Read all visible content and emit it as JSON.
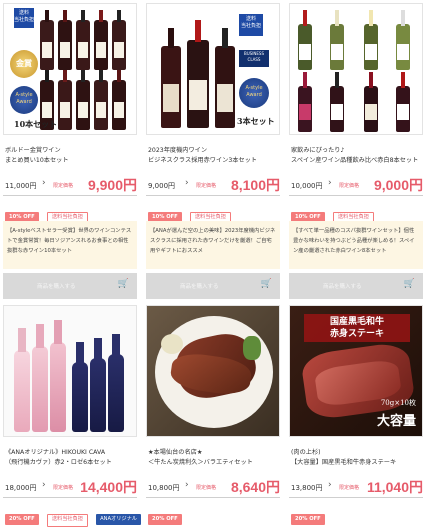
{
  "products": [
    {
      "title": "ボルドー金賞ワイン\nまとめ買い10本セット",
      "regular_price": "11,000円",
      "sale_label": "限定価格",
      "sale_price": "9,900円",
      "tags": [
        "10% OFF",
        "送料当社負担"
      ],
      "image_texts": {
        "badge": "送料\n当社負担",
        "gold": "金賞",
        "award": "A-style\nAward",
        "set": "10本セット"
      }
    },
    {
      "title": "2023年度機内ワイン\nビジネスクラス採用赤ワイン3本セット",
      "regular_price": "9,000円",
      "sale_label": "限定価格",
      "sale_price": "8,100円",
      "tags": [
        "10% OFF",
        "送料当社負担"
      ],
      "image_texts": {
        "badge": "送料\n当社負担",
        "business": "BUSINESS\nCLASS",
        "award": "A-style\nAward",
        "set": "3本セット"
      }
    },
    {
      "title": "家飲みにぴったり♪\nスペイン産ワイン品種飲み比べ赤白8本セット",
      "regular_price": "10,000円",
      "sale_label": "限定価格",
      "sale_price": "9,000円",
      "tags": [
        "10% OFF",
        "送料当社負担"
      ],
      "description": "【すべて単一品種のコスパ抜群ワインセット】個性豊かな味わいを持つぶどう品種が楽しめる！スペイン産の厳選された赤白ワイン8本セット",
      "cart_label": "商品を購入する"
    },
    {
      "title": "《ANAオリジナル》HIKOUKI CAVA\n（飛行機カヴァ）赤2・ロゼ6本セット",
      "regular_price": "18,000円",
      "sale_label": "限定価格",
      "sale_price": "14,400円",
      "tags": [
        "20% OFF",
        "送料当社負担",
        "ANAオリジナル"
      ]
    },
    {
      "title": "★本場仙台の名店★\n＜牛たん炭焼利久＞バラエティセット",
      "regular_price": "10,800円",
      "sale_label": "限定価格",
      "sale_price": "8,640円",
      "tags": [
        "20% OFF"
      ]
    },
    {
      "title": "(肉の上杉)\n【大容量】国産黒毛和牛赤身ステーキ",
      "regular_price": "13,800円",
      "sale_label": "限定価格",
      "sale_price": "11,040円",
      "tags": [
        "20% OFF"
      ],
      "image_texts": {
        "top": "国産黒毛和牛\n赤身ステーキ",
        "amount": "70g×10枚",
        "big": "大容量"
      }
    }
  ],
  "descriptions": [
    "【A-styleベストセラー受賞】世界のワインコンテストで金賞常賞！毎日ソジアンスれるお食事との相性抜群な赤ワイン10本セット",
    "【ANAが選んだ空の上の美味】2023年度機内ビジネスクラスに採用された赤ワインだけを厳選！ご自宅用やギフトにおススメ",
    "【すべて単一品種のコスパ抜群ワインセット】個性豊かな味わいを持つぶどう品種が楽しめる！スペイン産の厳選された赤白ワイン8本セット"
  ],
  "cart_label": "商品を購入する",
  "colors": {
    "sale": "#e65b6a",
    "off_tag": "#f47b7b",
    "ana_tag": "#2956a8",
    "desc_bg": "#fdf6e3",
    "cart_bg": "#d9d9d9"
  }
}
